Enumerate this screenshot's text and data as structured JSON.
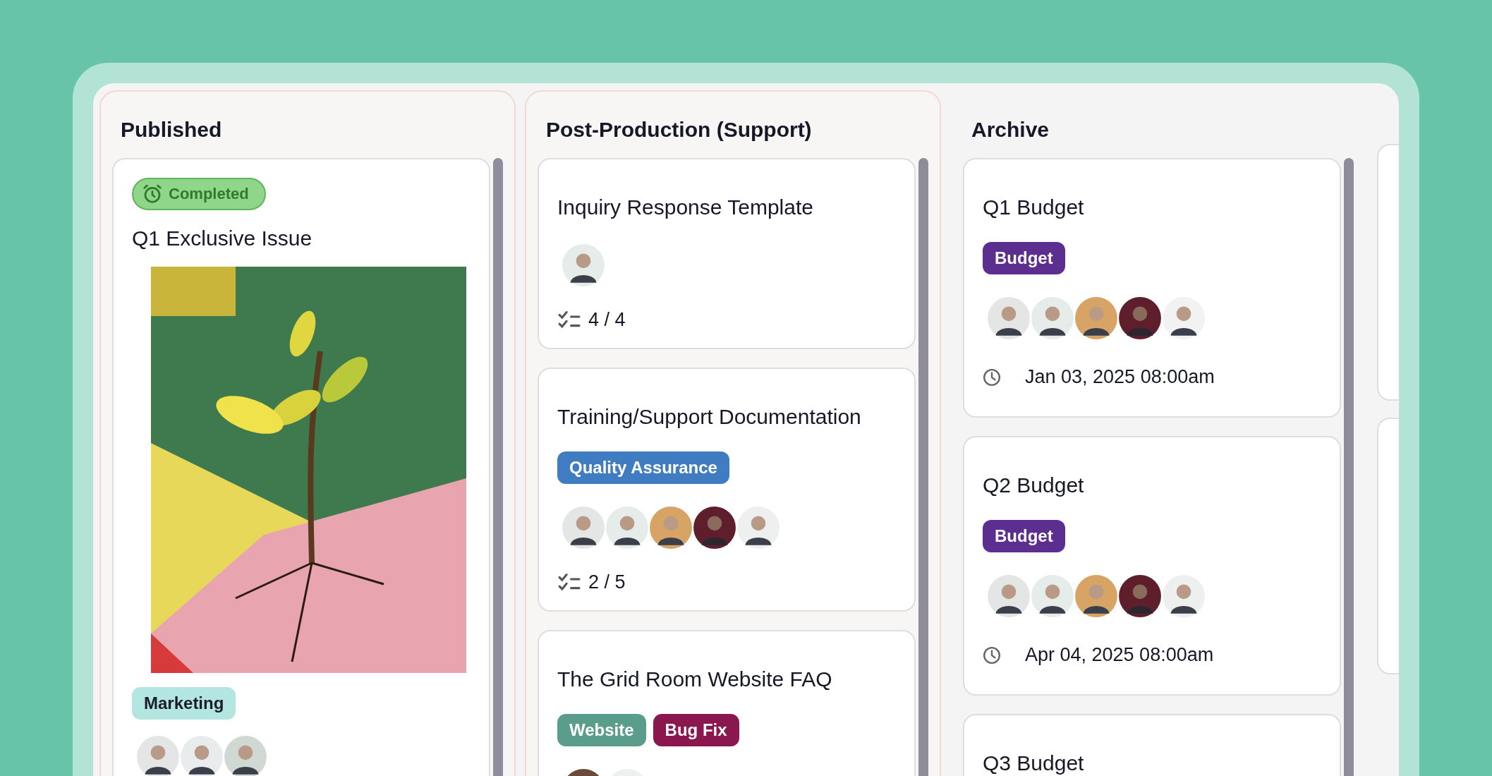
{
  "columns": [
    {
      "title": "Published",
      "outlined": true,
      "cards": [
        {
          "status": {
            "label": "Completed"
          },
          "title": "Q1 Exclusive Issue",
          "cover": true,
          "tags": [
            {
              "label": "Marketing",
              "color": "#b4e6e1"
            }
          ],
          "assignees": [
            {
              "color": "#e3e6e4"
            },
            {
              "color": "#e9ecec"
            },
            {
              "color": "#cfd8d2"
            }
          ]
        }
      ]
    },
    {
      "title": "Post-Production (Support)",
      "outlined": true,
      "cards": [
        {
          "title": "Inquiry Response Template",
          "assignees": [
            {
              "color": "#e6ece9"
            }
          ],
          "checklist": "4 / 4"
        },
        {
          "title": "Training/Support Documentation",
          "tags": [
            {
              "label": "Quality Assurance",
              "color": "#3f7cc1"
            }
          ],
          "assignees": [
            {
              "color": "#e3e6e4"
            },
            {
              "color": "#e6ece9"
            },
            {
              "color": "#d7a465"
            },
            {
              "color": "#5e1e2c"
            },
            {
              "color": "#eef0f0"
            }
          ],
          "checklist": "2 / 5"
        },
        {
          "title": "The Grid Room Website FAQ",
          "tags": [
            {
              "label": "Website",
              "color": "#5a9d8a"
            },
            {
              "label": "Bug Fix",
              "color": "#8a184f"
            }
          ],
          "assignees": [
            {
              "color": "#6b4a3a"
            },
            {
              "color": "#eef0f0"
            }
          ]
        }
      ]
    },
    {
      "title": "Archive",
      "outlined": false,
      "cards": [
        {
          "title": "Q1 Budget",
          "tags": [
            {
              "label": "Budget",
              "color": "#5b2e8f"
            }
          ],
          "assignees": [
            {
              "color": "#e3e6e4"
            },
            {
              "color": "#e6ece9"
            },
            {
              "color": "#d7a465"
            },
            {
              "color": "#5e1e2c"
            },
            {
              "color": "#f2f2f2"
            }
          ],
          "due": "Jan 03, 2025 08:00am"
        },
        {
          "title": "Q2 Budget",
          "tags": [
            {
              "label": "Budget",
              "color": "#5b2e8f"
            }
          ],
          "assignees": [
            {
              "color": "#e3e6e4"
            },
            {
              "color": "#e6ece9"
            },
            {
              "color": "#d7a465"
            },
            {
              "color": "#5e1e2c"
            },
            {
              "color": "#eef0f0"
            }
          ],
          "due": "Apr 04, 2025 08:00am"
        },
        {
          "title": "Q3 Budget"
        }
      ]
    }
  ]
}
